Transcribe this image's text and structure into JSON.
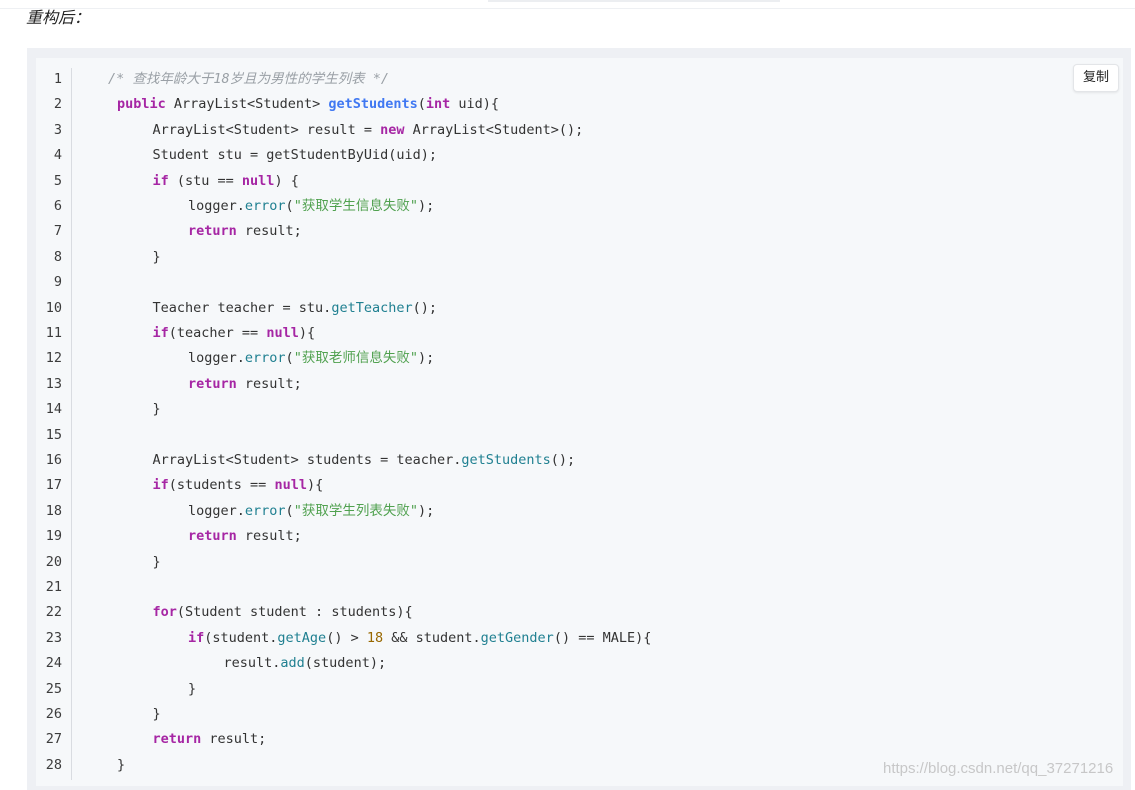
{
  "heading": "重构后：",
  "copy_label": "复制",
  "watermark": "https://blog.csdn.net/qq_37271216",
  "colors": {
    "keyword": "#a626a4",
    "function": "#4078f2",
    "call": "#208091",
    "string": "#50a14f",
    "number": "#986801",
    "comment": "#9aa0a6",
    "background": "#f6f8fa"
  },
  "code": {
    "language": "java",
    "lines": [
      {
        "n": "1",
        "indent": 0,
        "tokens": [
          {
            "t": "/* 查找年龄大于18岁且为男性的学生列表 */",
            "c": "cmt"
          }
        ]
      },
      {
        "n": "2",
        "indent": 0,
        "tokens": [
          {
            "t": "public",
            "c": "kw"
          },
          {
            "t": " ArrayList<Student> "
          },
          {
            "t": "getStudents",
            "c": "fn"
          },
          {
            "t": "("
          },
          {
            "t": "int",
            "c": "kw"
          },
          {
            "t": " uid){"
          }
        ]
      },
      {
        "n": "3",
        "indent": 1,
        "tokens": [
          {
            "t": "ArrayList<Student> result = "
          },
          {
            "t": "new",
            "c": "kw"
          },
          {
            "t": " ArrayList<Student>();"
          }
        ]
      },
      {
        "n": "4",
        "indent": 1,
        "tokens": [
          {
            "t": "Student stu = getStudentByUid(uid);"
          }
        ]
      },
      {
        "n": "5",
        "indent": 1,
        "tokens": [
          {
            "t": "if",
            "c": "kw"
          },
          {
            "t": " (stu == "
          },
          {
            "t": "null",
            "c": "kw"
          },
          {
            "t": ") {"
          }
        ]
      },
      {
        "n": "6",
        "indent": 2,
        "tokens": [
          {
            "t": "logger."
          },
          {
            "t": "error",
            "c": "call"
          },
          {
            "t": "("
          },
          {
            "t": "\"获取学生信息失败\"",
            "c": "str"
          },
          {
            "t": ");"
          }
        ]
      },
      {
        "n": "7",
        "indent": 2,
        "tokens": [
          {
            "t": "return",
            "c": "kw"
          },
          {
            "t": " result;"
          }
        ]
      },
      {
        "n": "8",
        "indent": 1,
        "tokens": [
          {
            "t": "}"
          }
        ]
      },
      {
        "n": "9",
        "indent": 0,
        "tokens": []
      },
      {
        "n": "10",
        "indent": 1,
        "tokens": [
          {
            "t": "Teacher teacher = stu."
          },
          {
            "t": "getTeacher",
            "c": "call"
          },
          {
            "t": "();"
          }
        ]
      },
      {
        "n": "11",
        "indent": 1,
        "tokens": [
          {
            "t": "if",
            "c": "kw"
          },
          {
            "t": "(teacher == "
          },
          {
            "t": "null",
            "c": "kw"
          },
          {
            "t": "){"
          }
        ]
      },
      {
        "n": "12",
        "indent": 2,
        "tokens": [
          {
            "t": "logger."
          },
          {
            "t": "error",
            "c": "call"
          },
          {
            "t": "("
          },
          {
            "t": "\"获取老师信息失败\"",
            "c": "str"
          },
          {
            "t": ");"
          }
        ]
      },
      {
        "n": "13",
        "indent": 2,
        "tokens": [
          {
            "t": "return",
            "c": "kw"
          },
          {
            "t": " result;"
          }
        ]
      },
      {
        "n": "14",
        "indent": 1,
        "tokens": [
          {
            "t": "}"
          }
        ]
      },
      {
        "n": "15",
        "indent": 0,
        "tokens": []
      },
      {
        "n": "16",
        "indent": 1,
        "tokens": [
          {
            "t": "ArrayList<Student> students = teacher."
          },
          {
            "t": "getStudents",
            "c": "call"
          },
          {
            "t": "();"
          }
        ]
      },
      {
        "n": "17",
        "indent": 1,
        "tokens": [
          {
            "t": "if",
            "c": "kw"
          },
          {
            "t": "(students == "
          },
          {
            "t": "null",
            "c": "kw"
          },
          {
            "t": "){"
          }
        ]
      },
      {
        "n": "18",
        "indent": 2,
        "tokens": [
          {
            "t": "logger."
          },
          {
            "t": "error",
            "c": "call"
          },
          {
            "t": "("
          },
          {
            "t": "\"获取学生列表失败\"",
            "c": "str"
          },
          {
            "t": ");"
          }
        ]
      },
      {
        "n": "19",
        "indent": 2,
        "tokens": [
          {
            "t": "return",
            "c": "kw"
          },
          {
            "t": " result;"
          }
        ]
      },
      {
        "n": "20",
        "indent": 1,
        "tokens": [
          {
            "t": "}"
          }
        ]
      },
      {
        "n": "21",
        "indent": 0,
        "tokens": []
      },
      {
        "n": "22",
        "indent": 1,
        "tokens": [
          {
            "t": "for",
            "c": "kw"
          },
          {
            "t": "(Student student : students){"
          }
        ]
      },
      {
        "n": "23",
        "indent": 2,
        "tokens": [
          {
            "t": "if",
            "c": "kw"
          },
          {
            "t": "(student."
          },
          {
            "t": "getAge",
            "c": "call"
          },
          {
            "t": "() > "
          },
          {
            "t": "18",
            "c": "num"
          },
          {
            "t": " && student."
          },
          {
            "t": "getGender",
            "c": "call"
          },
          {
            "t": "() == MALE){"
          }
        ]
      },
      {
        "n": "24",
        "indent": 3,
        "tokens": [
          {
            "t": "result."
          },
          {
            "t": "add",
            "c": "call"
          },
          {
            "t": "(student);"
          }
        ]
      },
      {
        "n": "25",
        "indent": 2,
        "tokens": [
          {
            "t": "}"
          }
        ]
      },
      {
        "n": "26",
        "indent": 1,
        "tokens": [
          {
            "t": "}"
          }
        ]
      },
      {
        "n": "27",
        "indent": 1,
        "tokens": [
          {
            "t": "return",
            "c": "kw"
          },
          {
            "t": " result;"
          }
        ]
      },
      {
        "n": "28",
        "indent": 0,
        "tokens": [
          {
            "t": "}"
          }
        ]
      }
    ]
  }
}
